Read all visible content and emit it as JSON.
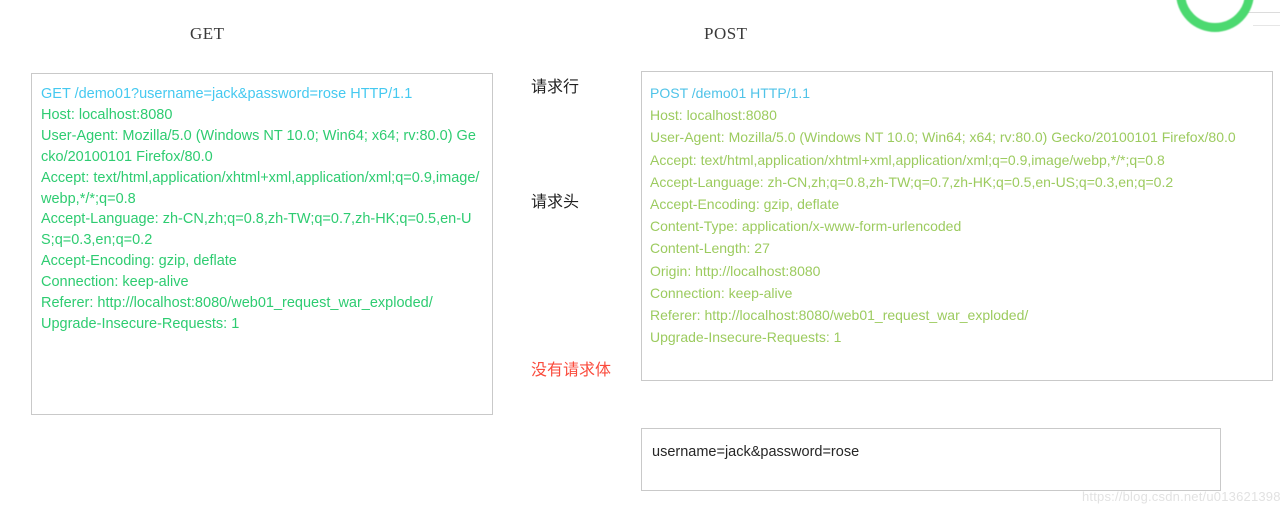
{
  "decor": {
    "ring_color": "#4cd970",
    "ring_name": "green-circle-ornament"
  },
  "titles": {
    "get": "GET",
    "post": "POST"
  },
  "annotations": {
    "request_line": "请求行",
    "request_header": "请求头",
    "no_request_body": "没有请求体",
    "no_body_color": "#fa4b3c"
  },
  "get_panel": {
    "border_color": "#c9c9c9",
    "request_line_color": "#45c9f0",
    "header_color": "#2ecc71",
    "request_line": "GET /demo01?username=jack&password=rose HTTP/1.1",
    "headers": [
      "Host: localhost:8080",
      "User-Agent: Mozilla/5.0 (Windows NT 10.0; Win64; x64; rv:80.0) Gecko/20100101 Firefox/80.0",
      "Accept: text/html,application/xhtml+xml,application/xml;q=0.9,image/webp,*/*;q=0.8",
      "Accept-Language: zh-CN,zh;q=0.8,zh-TW;q=0.7,zh-HK;q=0.5,en-US;q=0.3,en;q=0.2",
      "Accept-Encoding: gzip, deflate",
      "Connection: keep-alive",
      "Referer: http://localhost:8080/web01_request_war_exploded/",
      "Upgrade-Insecure-Requests: 1"
    ]
  },
  "post_panel": {
    "border_color": "#c9c9c9",
    "request_line_color": "#4fc3e8",
    "header_color": "#9ccb5f",
    "request_line": "POST /demo01 HTTP/1.1",
    "headers": [
      "Host: localhost:8080",
      "User-Agent: Mozilla/5.0 (Windows NT 10.0; Win64; x64; rv:80.0) Gecko/20100101 Firefox/80.0",
      "Accept: text/html,application/xhtml+xml,application/xml;q=0.9,image/webp,*/*;q=0.8",
      "Accept-Language: zh-CN,zh;q=0.8,zh-TW;q=0.7,zh-HK;q=0.5,en-US;q=0.3,en;q=0.2",
      "Accept-Encoding: gzip, deflate",
      "Content-Type: application/x-www-form-urlencoded",
      "Content-Length: 27",
      "Origin: http://localhost:8080",
      "Connection: keep-alive",
      "Referer: http://localhost:8080/web01_request_war_exploded/",
      "Upgrade-Insecure-Requests: 1"
    ]
  },
  "body_panel": {
    "border_color": "#c9c9c9",
    "text": "username=jack&password=rose"
  },
  "watermark": {
    "text": "https://blog.csdn.net/u013621398"
  }
}
